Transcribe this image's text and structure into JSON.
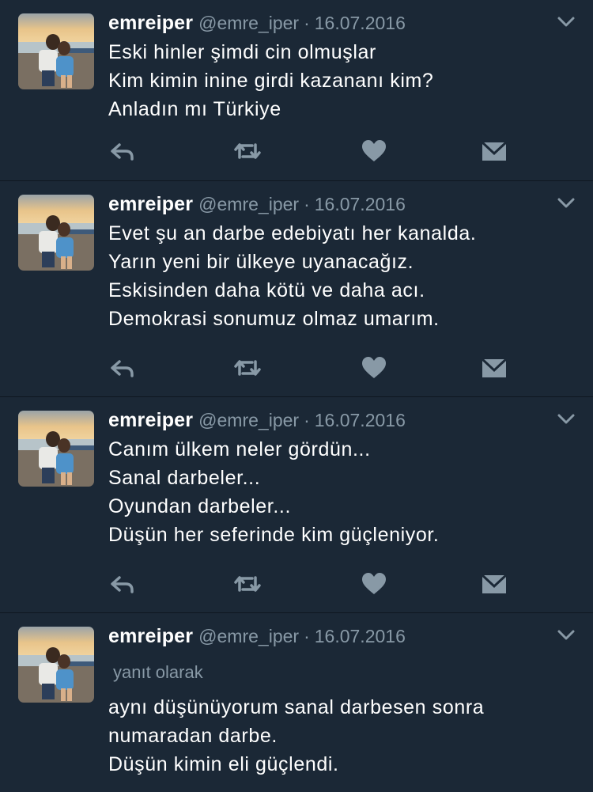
{
  "tweets": [
    {
      "name": "emreiper",
      "handle": "@emre_iper",
      "separator": "·",
      "date": "16.07.2016",
      "lines": [
        "Eski hinler şimdi cin olmuşlar",
        "Kim kimin inine girdi kazananı kim?",
        "Anladın mı Türkiye"
      ]
    },
    {
      "name": "emreiper",
      "handle": "@emre_iper",
      "separator": "·",
      "date": "16.07.2016",
      "lines": [
        "Evet şu an darbe edebiyatı her kanalda.",
        "Yarın yeni bir ülkeye uyanacağız.",
        "Eskisinden daha kötü ve daha acı.",
        "Demokrasi sonumuz olmaz umarım."
      ]
    },
    {
      "name": "emreiper",
      "handle": "@emre_iper",
      "separator": "·",
      "date": "16.07.2016",
      "lines": [
        "Canım ülkem neler gördün...",
        "Sanal darbeler...",
        "Oyundan darbeler...",
        "Düşün her seferinde kim güçleniyor."
      ]
    },
    {
      "name": "emreiper",
      "handle": "@emre_iper",
      "separator": "·",
      "date": "16.07.2016",
      "reply_label": "yanıt olarak",
      "lines": [
        "aynı düşünüyorum sanal darbesen sonra",
        "numaradan darbe.",
        "Düşün kimin eli güçlendi."
      ]
    }
  ],
  "icons": {
    "reply": "reply-icon",
    "retweet": "retweet-icon",
    "like": "heart-icon",
    "dm": "direct-message-icon",
    "menu": "chevron-down-icon"
  },
  "colors": {
    "background": "#1b2836",
    "secondary_text": "#8899a6",
    "divider": "#0f1720"
  }
}
